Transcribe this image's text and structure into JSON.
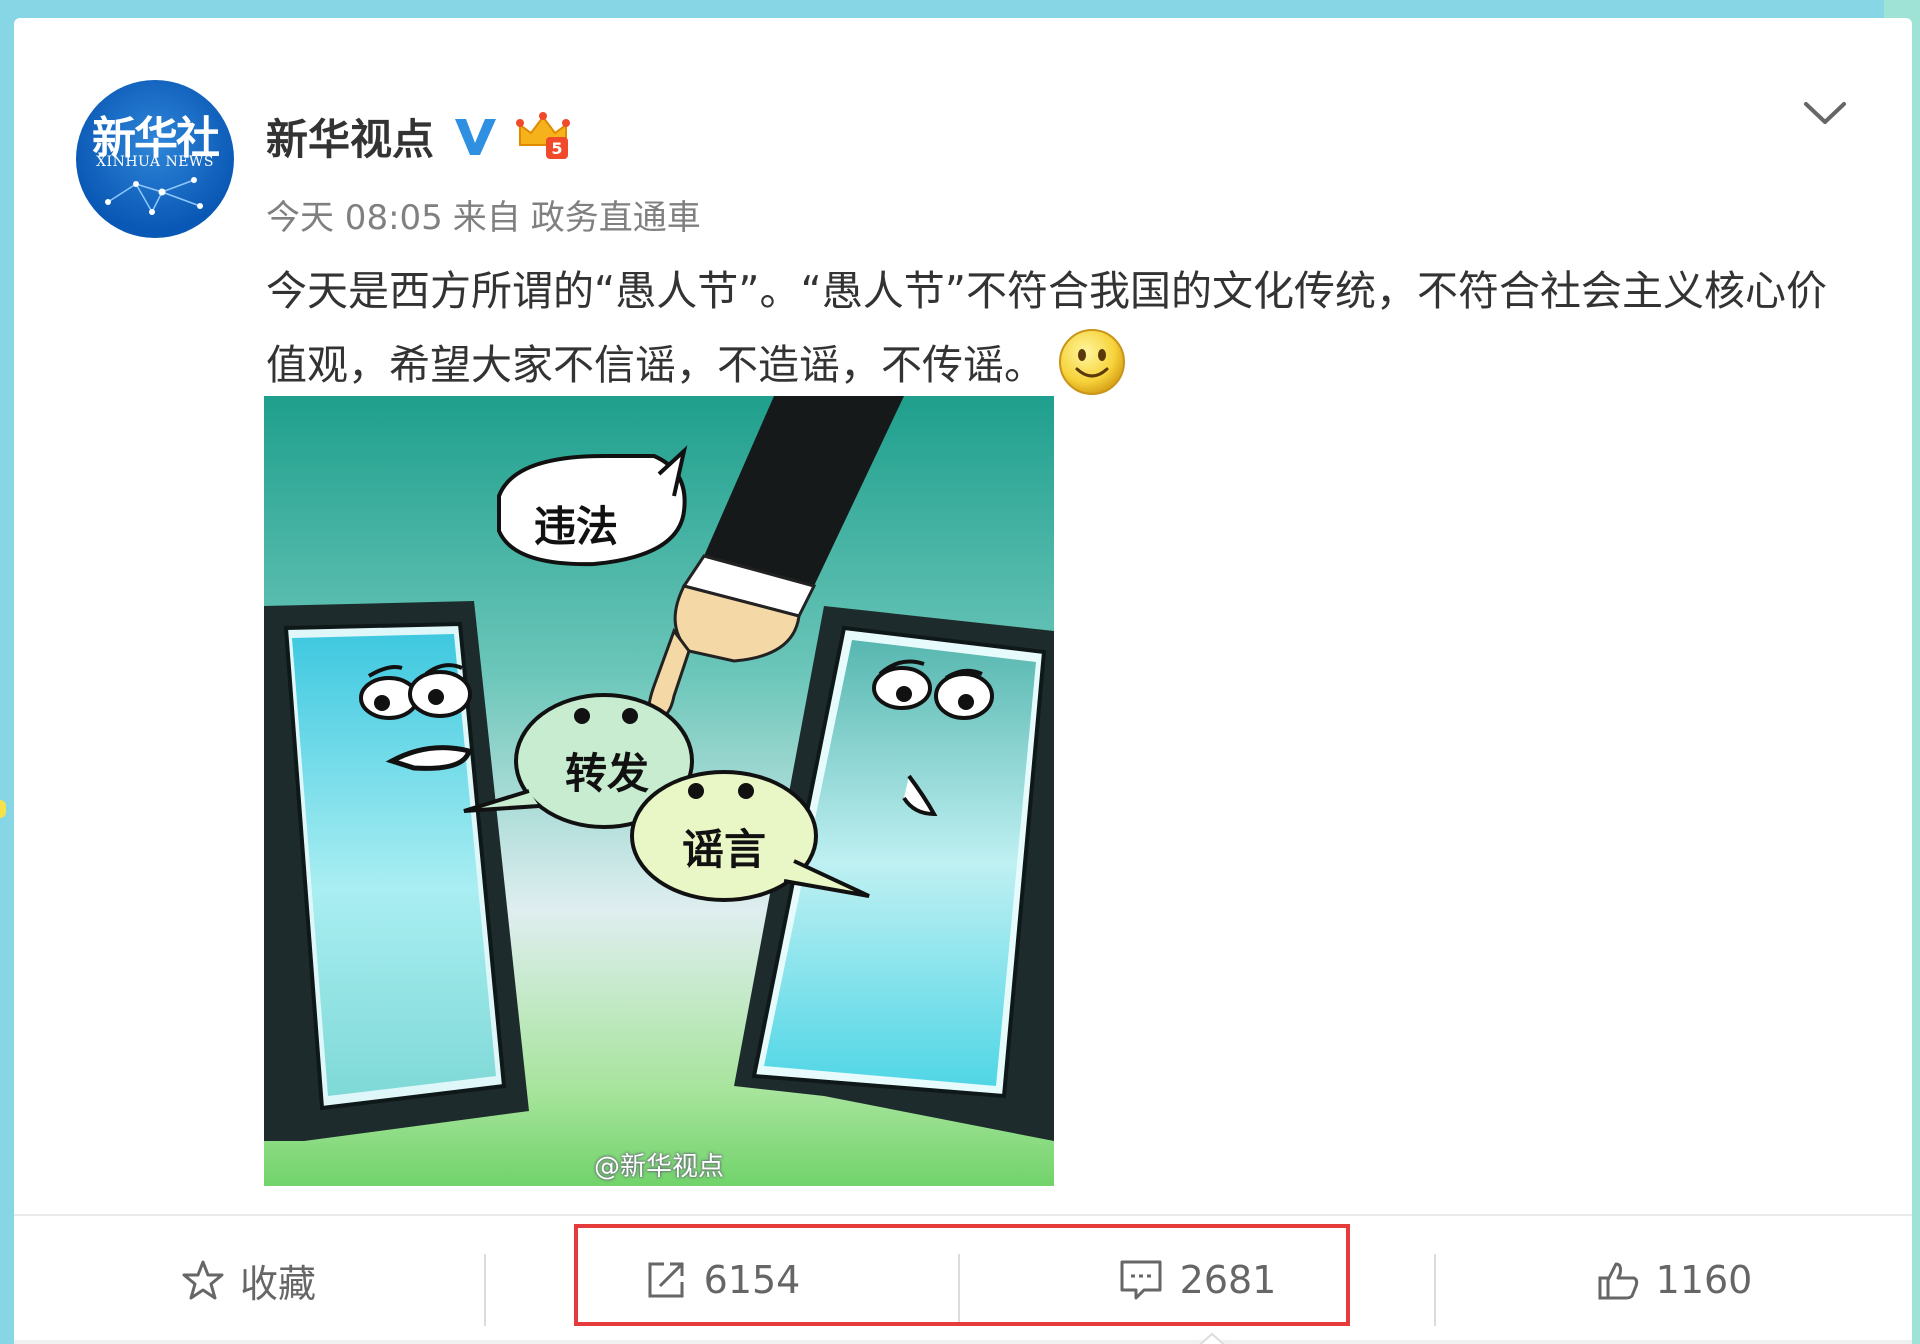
{
  "post": {
    "avatar_logo": "新华社",
    "avatar_sub": "XINHUA NEWS",
    "username": "新华视点",
    "time": "今天 08:05",
    "from_label": "来自",
    "source": "政务直通車",
    "text": "今天是西方所谓的“愚人节”。“愚人节”不符合我国的文化传统，不符合社会主义核心价值观，希望大家不信谣，不造谣，不传谣。",
    "image": {
      "bubble_1": "违法",
      "bubble_2": "转发",
      "bubble_3": "谣言",
      "watermark": "@新华视点"
    }
  },
  "actions": {
    "favorite_label": "收藏",
    "repost_count": "6154",
    "comment_count": "2681",
    "like_count": "1160"
  },
  "icons": {
    "verified": "verified-v-icon",
    "crown": "vip-crown-icon",
    "more": "chevron-down-icon",
    "favorite": "star-icon",
    "repost": "share-icon",
    "comment": "comment-icon",
    "like": "thumbs-up-icon",
    "emoji": "smile-emoji-icon"
  },
  "colors": {
    "highlight": "#e63b3b",
    "verified": "#2f8fe0"
  }
}
